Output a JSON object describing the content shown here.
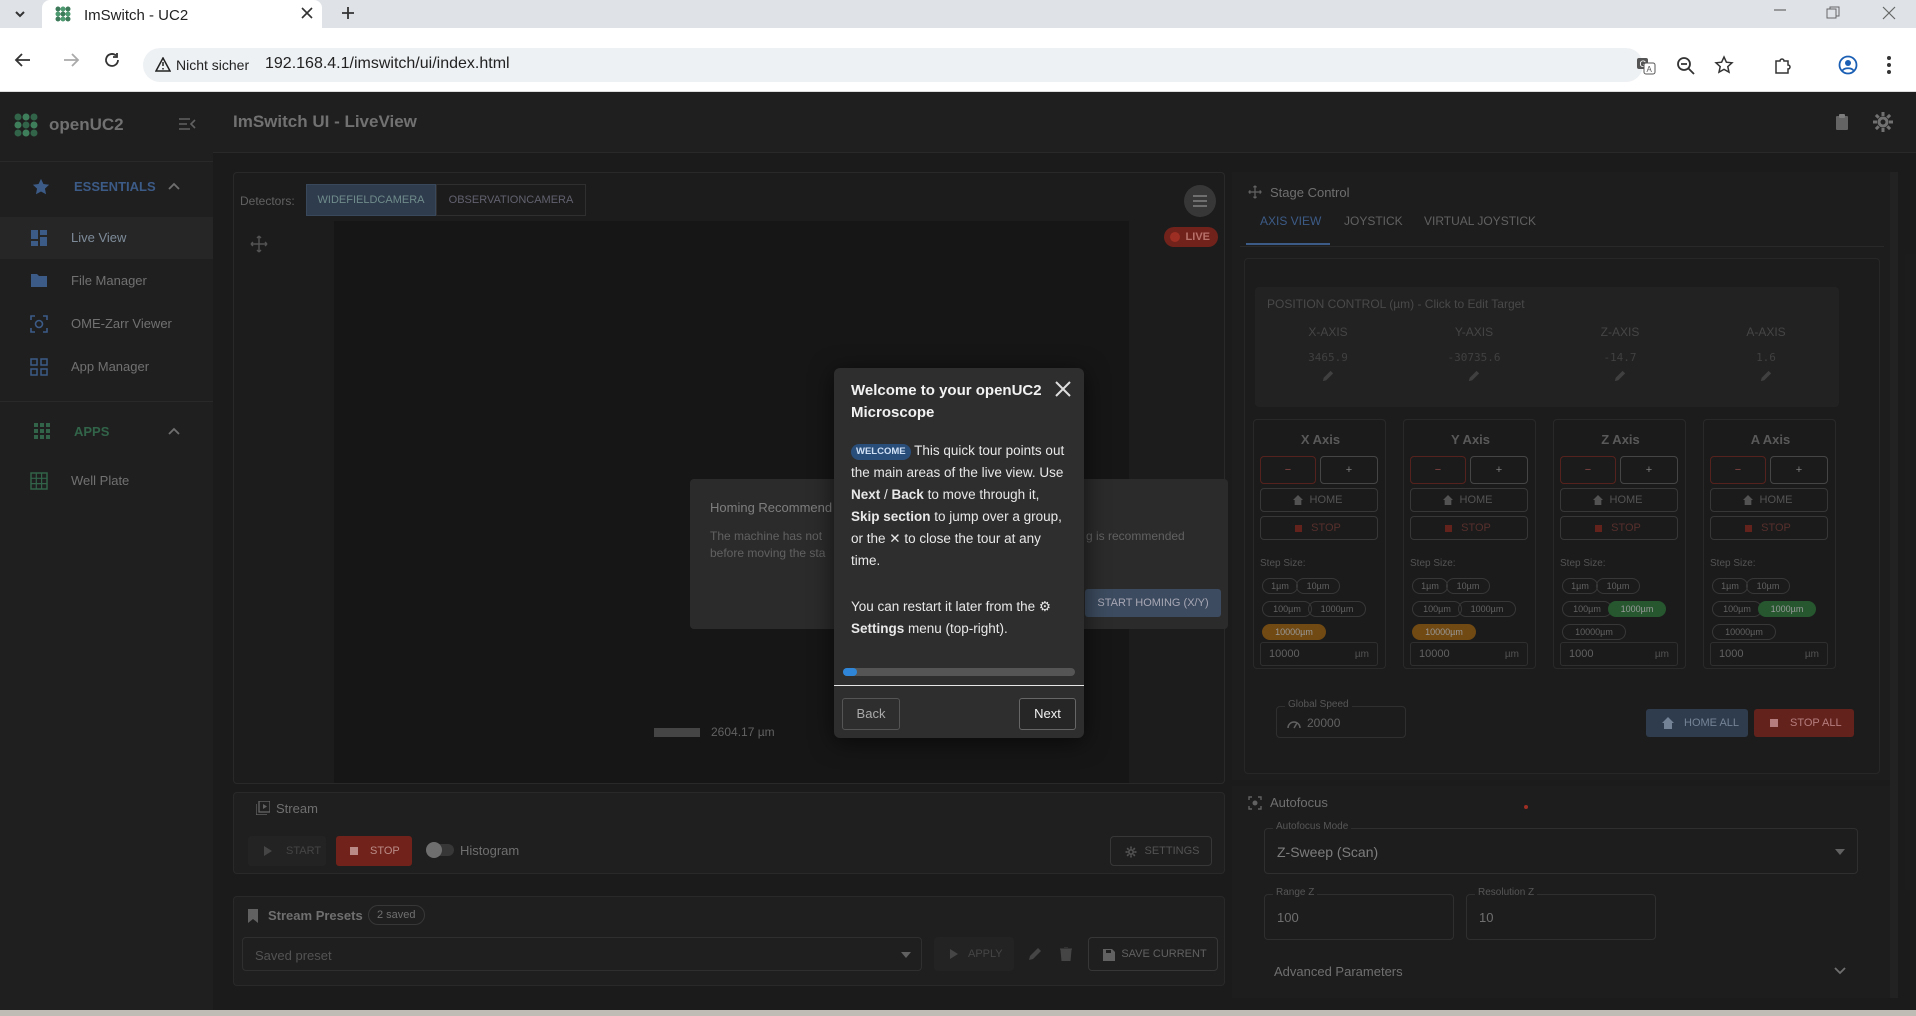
{
  "browser": {
    "tab_title": "ImSwitch - UC2",
    "security_label": "Nicht sicher",
    "url": "192.168.4.1/imswitch/ui/index.html"
  },
  "sidebar": {
    "brand": "openUC2",
    "section_essentials": "ESSENTIALS",
    "items": [
      {
        "label": "Live View"
      },
      {
        "label": "File Manager"
      },
      {
        "label": "OME-Zarr Viewer"
      },
      {
        "label": "App Manager"
      }
    ],
    "section_apps": "APPS",
    "apps": [
      {
        "label": "Well Plate"
      }
    ]
  },
  "header": {
    "title": "ImSwitch UI - LiveView"
  },
  "detectors": {
    "label": "Detectors:",
    "tabs": [
      "WIDEFIELDCAMERA",
      "OBSERVATIONCAMERA"
    ]
  },
  "live_badge": "LIVE",
  "scale_bar": "2604.17 µm",
  "homing": {
    "title": "Homing Recommend",
    "text_left_1": "The machine has not",
    "text_right_1": "g is recommended",
    "text_left_2": "before moving the sta",
    "button": "START HOMING (X/Y)"
  },
  "stream": {
    "title": "Stream",
    "start": "START",
    "stop": "STOP",
    "histogram": "Histogram",
    "settings": "SETTINGS"
  },
  "presets": {
    "title": "Stream Presets",
    "count": "2 saved",
    "placeholder": "Saved preset",
    "apply": "APPLY",
    "save": "SAVE CURRENT"
  },
  "stage": {
    "title": "Stage Control",
    "tabs": [
      "AXIS VIEW",
      "JOYSTICK",
      "VIRTUAL JOYSTICK"
    ],
    "position_header": "POSITION CONTROL (µm) - Click to Edit Target",
    "positions": [
      {
        "axis": "X-AXIS",
        "value": "3465.9"
      },
      {
        "axis": "Y-AXIS",
        "value": "-30735.6"
      },
      {
        "axis": "Z-AXIS",
        "value": "-14.7"
      },
      {
        "axis": "A-AXIS",
        "value": "1.6"
      }
    ],
    "home_label": "HOME",
    "stop_label": "STOP",
    "step_label": "Step Size:",
    "unit": "µm",
    "step_chips": [
      "1µm",
      "10µm",
      "100µm",
      "1000µm",
      "10000µm"
    ],
    "axes": [
      {
        "name": "X Axis",
        "value": "10000",
        "active": 4,
        "color": "#8a5a17"
      },
      {
        "name": "Y Axis",
        "value": "10000",
        "active": 4,
        "color": "#8a5a17"
      },
      {
        "name": "Z Axis",
        "value": "1000",
        "active": 3,
        "color": "#2f6b3a"
      },
      {
        "name": "A Axis",
        "value": "1000",
        "active": 3,
        "color": "#2f6b3a"
      }
    ],
    "global_speed_label": "Global Speed",
    "global_speed": "20000",
    "home_all": "HOME ALL",
    "stop_all": "STOP ALL"
  },
  "autofocus": {
    "title": "Autofocus",
    "mode_label": "Autofocus Mode",
    "mode": "Z-Sweep (Scan)",
    "range_label": "Range Z",
    "range": "100",
    "resolution_label": "Resolution Z",
    "resolution": "10",
    "advanced": "Advanced Parameters"
  },
  "tour": {
    "title": "Welcome to your openUC2 Microscope",
    "badge": "WELCOME",
    "p1_a": "This quick tour points out the main areas of the live view. Use ",
    "next_word": "Next",
    "slash": " / ",
    "back_word": "Back",
    "p1_b": " to move through it, ",
    "skip_word": "Skip section",
    "p1_c": " to jump over a group, or the ",
    "x_glyph": "✕",
    "p1_d": " to close the tour at any time.",
    "p2_a": "You can restart it later from the ",
    "gear_glyph": "⚙",
    "settings_word": "Settings",
    "p2_b": " menu (top-right).",
    "progress": 0.06,
    "back": "Back",
    "next": "Next"
  },
  "colors": {
    "accent": "#5b8ed6",
    "live": "#c0392b",
    "stop": "#c0392b",
    "progress": "#2f86d8"
  }
}
